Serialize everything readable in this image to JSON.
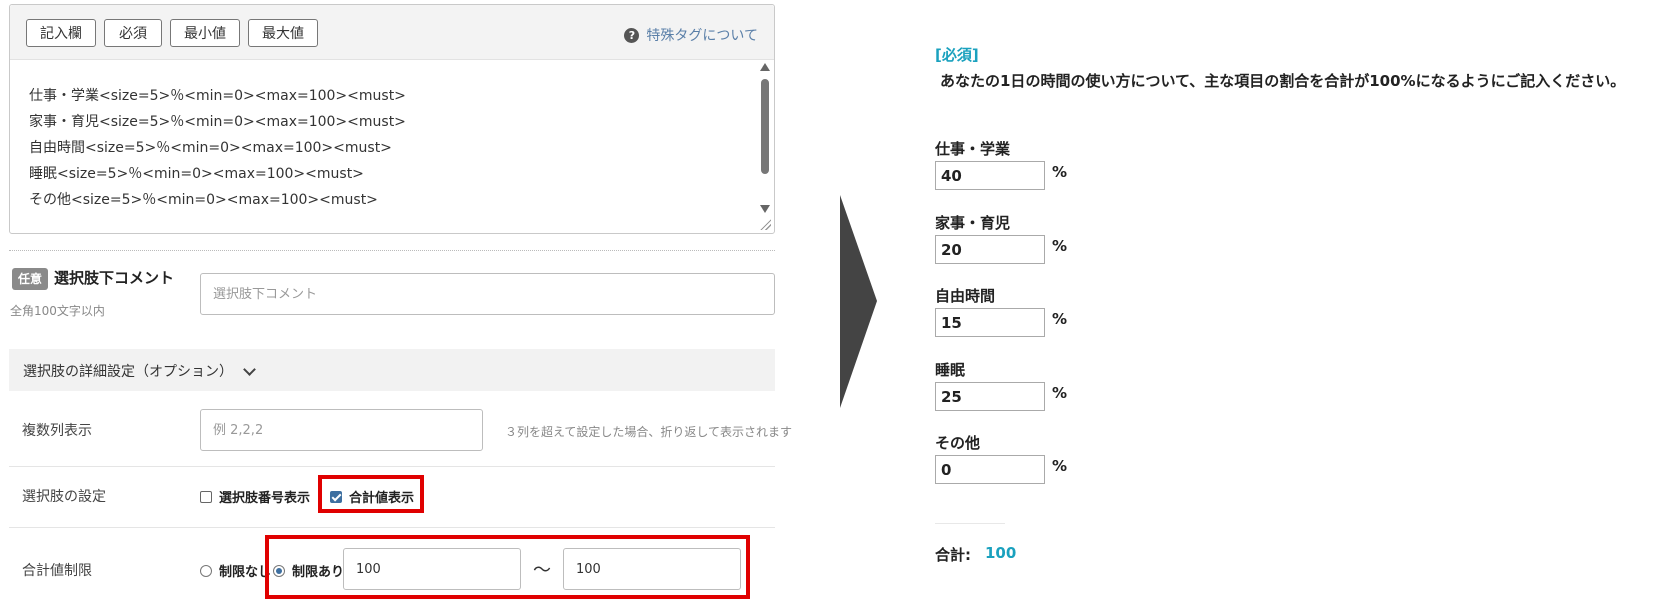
{
  "editor": {
    "tag_buttons": [
      "記入欄",
      "必須",
      "最小値",
      "最大値"
    ],
    "help_link": "特殊タグについて",
    "lines": [
      "仕事・学業<size=5>％<min=0><max=100><must>",
      "家事・育児<size=5>％<min=0><max=100><must>",
      "自由時間<size=5>％<min=0><max=100><must>",
      "睡眠<size=5>％<min=0><max=100><must>",
      "その他<size=5>％<min=0><max=100><must>"
    ]
  },
  "comment_section": {
    "badge": "任意",
    "title": "選択肢下コメント",
    "note": "全角100文字以内",
    "placeholder": "選択肢下コメント"
  },
  "detail": {
    "header": "選択肢の詳細設定（オプション）",
    "columns": {
      "label": "複数列表示",
      "placeholder": "例 2,2,2",
      "hint": "３列を超えて設定した場合、折り返して表示されます"
    },
    "choice_settings": {
      "label": "選択肢の設定",
      "option_number": {
        "label": "選択肢番号表示",
        "checked": false
      },
      "option_total": {
        "label": "合計値表示",
        "checked": true
      }
    },
    "total_limit": {
      "label": "合計値制限",
      "no_limit": {
        "label": "制限なし",
        "selected": false
      },
      "with_limit": {
        "label": "制限あり",
        "selected": true
      },
      "min": "100",
      "tilde": "〜",
      "max": "100"
    }
  },
  "preview": {
    "required_tag": "[必須]",
    "question": "あなたの1日の時間の使い方について、主な項目の割合を合計が100%になるようにご記入ください。",
    "items": [
      {
        "label": "仕事・学業",
        "value": "40",
        "unit": "%"
      },
      {
        "label": "家事・育児",
        "value": "20",
        "unit": "%"
      },
      {
        "label": "自由時間",
        "value": "15",
        "unit": "%"
      },
      {
        "label": "睡眠",
        "value": "25",
        "unit": "%"
      },
      {
        "label": "その他",
        "value": "0",
        "unit": "%"
      }
    ],
    "total_label": "合計:",
    "total_value": "100"
  },
  "colors": {
    "accent": "#1aa1be",
    "highlight_border": "#e00000",
    "checkbox_on": "#3d6fa0",
    "arrow": "#444444"
  }
}
